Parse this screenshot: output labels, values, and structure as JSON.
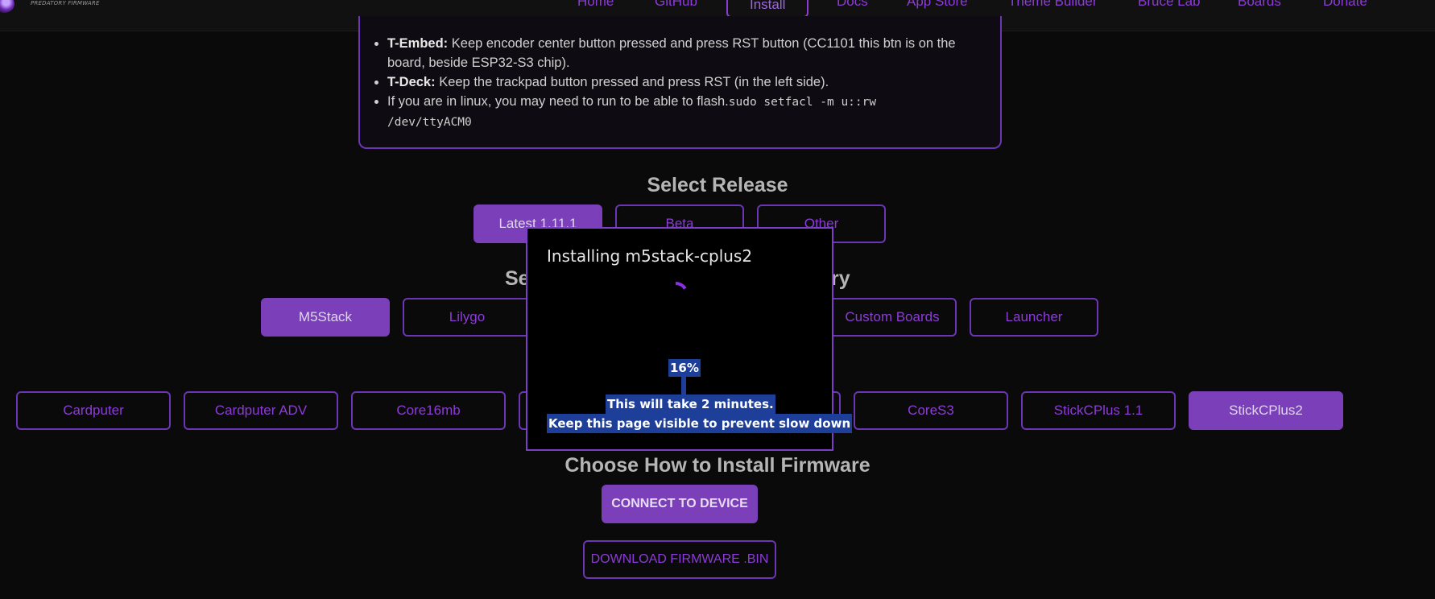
{
  "nav": {
    "logo_text": "PREDATORY FIRMWARE",
    "items": [
      "Home",
      "GitHub",
      "Install",
      "Docs",
      "App Store",
      "Theme Builder",
      "Bruce Lab",
      "Boards",
      "Donate"
    ]
  },
  "notes": {
    "tembed_label": "T-Embed:",
    "tembed_text": " Keep encoder center button pressed and press RST button (CC1101 this btn is on the board, beside ESP32-S3 chip).",
    "tdeck_label": "T-Deck:",
    "tdeck_text": " Keep the trackpad button pressed and press RST (in the left side).",
    "linux_text": "If you are in linux, you may need to run to be able to flash.",
    "linux_cmd_1": "sudo setfacl -m u::rw",
    "linux_cmd_2": "/dev/ttyACM0"
  },
  "release": {
    "title": "Select Release",
    "options": [
      "Latest 1.11.1",
      "Beta",
      "Other"
    ]
  },
  "category": {
    "title_left": "Se",
    "title_right": "ry",
    "options": [
      "M5Stack",
      "Lilygo",
      "Custom Boards",
      "Launcher"
    ]
  },
  "devices": {
    "options": [
      "Cardputer",
      "Cardputer ADV",
      "Core16mb",
      "CoreS3",
      "StickCPlus 1.1",
      "StickCPlus2"
    ]
  },
  "install": {
    "title": "Choose How to Install Firmware",
    "connect_label": "CONNECT TO DEVICE",
    "download_label": "DOWNLOAD FIRMWARE .BIN"
  },
  "modal": {
    "title": "Installing m5stack-cplus2",
    "percent": "16%",
    "progress": 0.16,
    "message_1": "This will take 2 minutes.",
    "message_2": "Keep this page visible to prevent slow down"
  },
  "colors": {
    "accent": "#8c3cd6",
    "selected_fill": "#7a3fb9",
    "selection_highlight": "#1e3f99",
    "background": "#0a0a0a"
  }
}
